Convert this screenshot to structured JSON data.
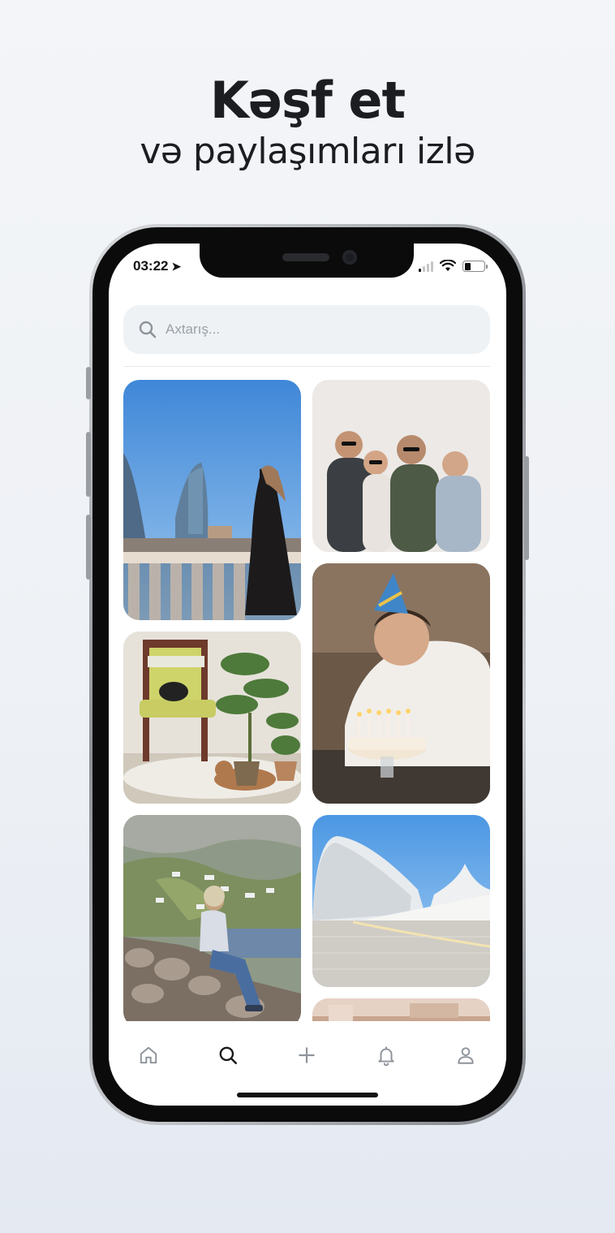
{
  "headline": {
    "title": "Kəşf et",
    "subtitle": "və paylaşımları izlə"
  },
  "status_bar": {
    "time": "03:22"
  },
  "search": {
    "placeholder": "Axtarış..."
  },
  "feed": {
    "tiles": [
      {
        "name": "photo-flame-towers-woman"
      },
      {
        "name": "photo-friends-laughing"
      },
      {
        "name": "photo-birthday-cake-boy"
      },
      {
        "name": "photo-chair-cats-plants"
      },
      {
        "name": "photo-mountain-village-boy"
      },
      {
        "name": "photo-heydar-aliyev-center"
      },
      {
        "name": "photo-interior-partial"
      }
    ]
  },
  "tabbar": {
    "items": [
      {
        "icon": "home-icon",
        "active": false
      },
      {
        "icon": "search-icon",
        "active": true
      },
      {
        "icon": "plus-icon",
        "active": false
      },
      {
        "icon": "bell-icon",
        "active": false
      },
      {
        "icon": "user-icon",
        "active": false
      }
    ]
  },
  "colors": {
    "search_bg": "#eef2f5",
    "active_icon": "#1a1a1a",
    "inactive_icon": "#8d939a"
  }
}
